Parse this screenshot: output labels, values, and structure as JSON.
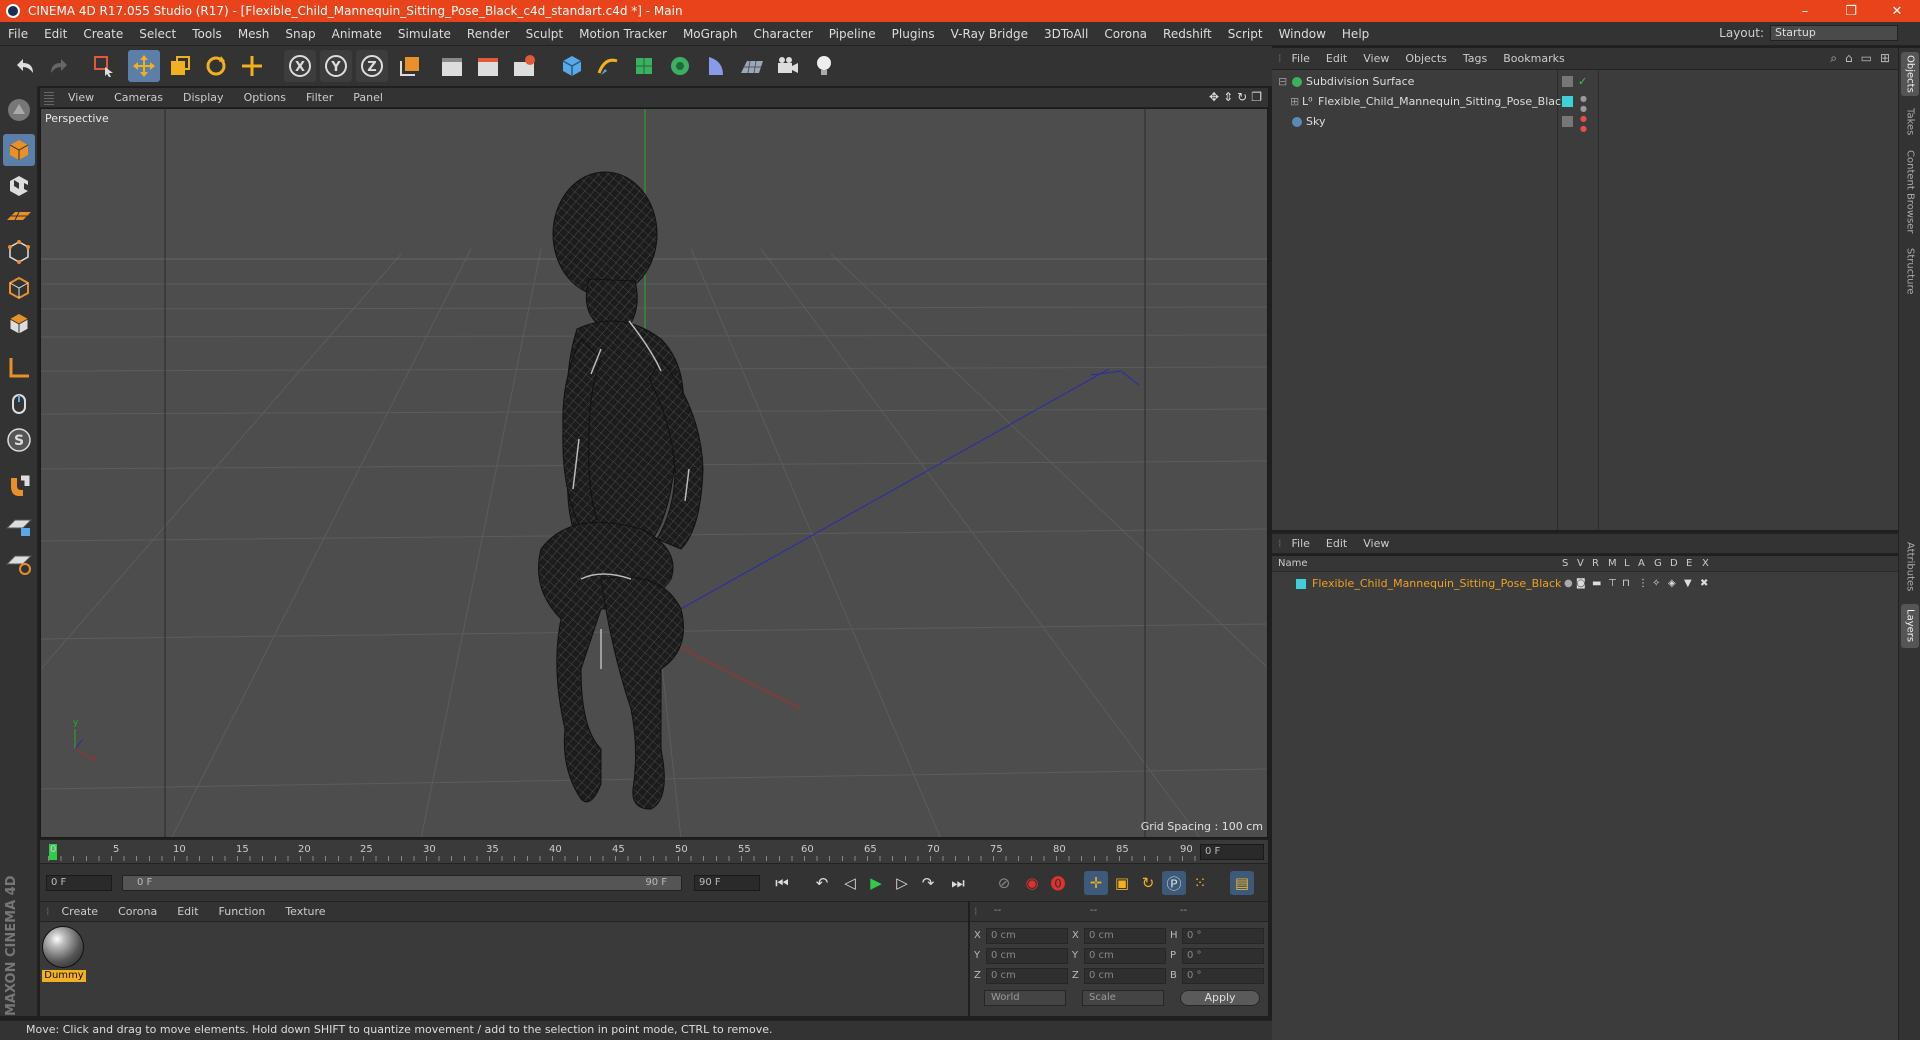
{
  "window": {
    "title": "CINEMA 4D R17.055 Studio (R17) - [Flexible_Child_Mannequin_Sitting_Pose_Black_c4d_standart.c4d *] - Main",
    "minimize": "–",
    "restore": "❐",
    "close": "✕"
  },
  "menubar": {
    "items": [
      "File",
      "Edit",
      "Create",
      "Select",
      "Tools",
      "Mesh",
      "Snap",
      "Animate",
      "Simulate",
      "Render",
      "Sculpt",
      "Motion Tracker",
      "MoGraph",
      "Character",
      "Pipeline",
      "Plugins",
      "V-Ray Bridge",
      "3DToAll",
      "Corona",
      "Redshift",
      "Script",
      "Window",
      "Help"
    ],
    "layout_label": "Layout:",
    "layout_value": "Startup"
  },
  "viewport": {
    "menu": [
      "View",
      "Cameras",
      "Display",
      "Options",
      "Filter",
      "Panel"
    ],
    "label": "Perspective",
    "grid_spacing": "Grid Spacing : 100 cm"
  },
  "timeline": {
    "ticks": [
      "0",
      "5",
      "10",
      "15",
      "20",
      "25",
      "30",
      "35",
      "40",
      "45",
      "50",
      "55",
      "60",
      "65",
      "70",
      "75",
      "80",
      "85",
      "90"
    ],
    "current_frame": "0 F",
    "start_field": "0 F",
    "range_start": "0 F",
    "range_end": "90 F",
    "end_field": "90 F"
  },
  "material_panel": {
    "menu": [
      "Create",
      "Corona",
      "Edit",
      "Function",
      "Texture"
    ],
    "material_name": "Dummy"
  },
  "coordinates": {
    "headers": [
      "--",
      "--",
      "--"
    ],
    "rows": [
      {
        "a": "X",
        "av": "0 cm",
        "b": "X",
        "bv": "0 cm",
        "c": "H",
        "cv": "0 °"
      },
      {
        "a": "Y",
        "av": "0 cm",
        "b": "Y",
        "bv": "0 cm",
        "c": "P",
        "cv": "0 °"
      },
      {
        "a": "Z",
        "av": "0 cm",
        "b": "Z",
        "bv": "0 cm",
        "c": "B",
        "cv": "0 °"
      }
    ],
    "world": "World",
    "scale": "Scale",
    "apply": "Apply"
  },
  "status": {
    "text": "Move: Click and drag to move elements. Hold down SHIFT to quantize movement / add to the selection in point mode, CTRL to remove."
  },
  "object_manager": {
    "menu": [
      "File",
      "Edit",
      "View",
      "Objects",
      "Tags",
      "Bookmarks"
    ],
    "objects": [
      "Subdivision Surface",
      "Flexible_Child_Mannequin_Sitting_Pose_Black",
      "Sky"
    ]
  },
  "layer_manager": {
    "menu": [
      "File",
      "Edit",
      "View"
    ],
    "columns": [
      "Name",
      "S",
      "V",
      "R",
      "M",
      "L",
      "A",
      "G",
      "D",
      "E",
      "X"
    ],
    "layer_name": "Flexible_Child_Mannequin_Sitting_Pose_Black"
  },
  "right_tabs": [
    "Objects",
    "Takes",
    "Content Browser",
    "Structure",
    "Attributes",
    "Layers"
  ],
  "brand": "MAXON CINEMA 4D",
  "colors": {
    "title_bar": "#e8431b",
    "selection_blue": "#5b7fa8",
    "layer_cyan": "#3fd0d8",
    "layer_name": "#f0a020",
    "play_green": "#2fcc4a"
  }
}
